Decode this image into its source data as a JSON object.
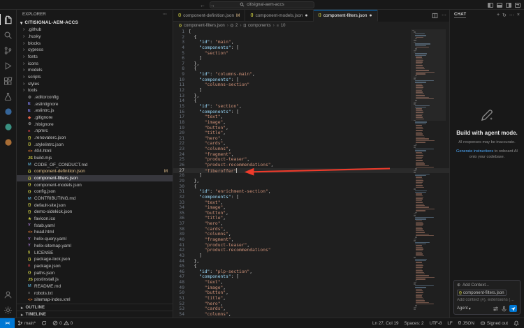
{
  "window": {
    "search_value": "citisignal-aem-accs"
  },
  "activity_bar": {
    "top": [
      {
        "name": "explorer",
        "active": true
      },
      {
        "name": "search",
        "active": false
      },
      {
        "name": "source-control",
        "active": false
      },
      {
        "name": "run-and-debug",
        "active": false
      },
      {
        "name": "extensions",
        "active": false
      },
      {
        "name": "testing",
        "active": false
      },
      {
        "name": "extension-blue",
        "active": false,
        "color": "#3f7fc4"
      },
      {
        "name": "extension-teal",
        "active": false,
        "color": "#45b8a5"
      },
      {
        "name": "extension-orange",
        "active": false,
        "color": "#d88a3f"
      }
    ],
    "bottom": [
      {
        "name": "accounts"
      },
      {
        "name": "settings"
      }
    ]
  },
  "sidebar": {
    "title": "EXPLORER",
    "more_label": "⋯",
    "root": "CITISIGNAL-AEM-ACCS",
    "items": [
      {
        "label": ".github",
        "icon": "folder"
      },
      {
        "label": ".husky",
        "icon": "folder"
      },
      {
        "label": "blocks",
        "icon": "folder"
      },
      {
        "label": "cypress",
        "icon": "folder"
      },
      {
        "label": "fonts",
        "icon": "folder"
      },
      {
        "label": "icons",
        "icon": "folder"
      },
      {
        "label": "models",
        "icon": "folder"
      },
      {
        "label": "scripts",
        "icon": "folder"
      },
      {
        "label": "styles",
        "icon": "folder"
      },
      {
        "label": "tools",
        "icon": "folder"
      },
      {
        "label": ".editorconfig",
        "icon": "gear"
      },
      {
        "label": ".eslintignore",
        "icon": "eslint"
      },
      {
        "label": ".eslintrc.js",
        "icon": "eslint"
      },
      {
        "label": ".gitignore",
        "icon": "git"
      },
      {
        "label": ".hlxignore",
        "icon": "gear"
      },
      {
        "label": ".npmrc",
        "icon": "npm"
      },
      {
        "label": ".renovaterc.json",
        "icon": "json"
      },
      {
        "label": ".stylelintrc.json",
        "icon": "json"
      },
      {
        "label": "404.html",
        "icon": "html"
      },
      {
        "label": "build.mjs",
        "icon": "js"
      },
      {
        "label": "CODE_OF_CONDUCT.md",
        "icon": "md"
      },
      {
        "label": "component-definition.json",
        "icon": "json",
        "git": "M"
      },
      {
        "label": "component-filters.json",
        "icon": "json",
        "selected": true
      },
      {
        "label": "component-models.json",
        "icon": "json"
      },
      {
        "label": "config.json",
        "icon": "json"
      },
      {
        "label": "CONTRIBUTING.md",
        "icon": "md"
      },
      {
        "label": "default-site.json",
        "icon": "json"
      },
      {
        "label": "demo-sidekick.json",
        "icon": "json"
      },
      {
        "label": "favicon.ico",
        "icon": "star"
      },
      {
        "label": "fstab.yaml",
        "icon": "yaml"
      },
      {
        "label": "head.html",
        "icon": "html"
      },
      {
        "label": "helix-query.yaml",
        "icon": "yaml"
      },
      {
        "label": "helix-sitemap.yaml",
        "icon": "yaml"
      },
      {
        "label": "LICENSE",
        "icon": "license"
      },
      {
        "label": "package-lock.json",
        "icon": "json"
      },
      {
        "label": "package.json",
        "icon": "npm"
      },
      {
        "label": "paths.json",
        "icon": "json"
      },
      {
        "label": "postinstall.js",
        "icon": "js"
      },
      {
        "label": "README.md",
        "icon": "md"
      },
      {
        "label": "robots.txt",
        "icon": "txt"
      },
      {
        "label": "sitemap-index.xml",
        "icon": "xml"
      }
    ],
    "bottom_sections": [
      "OUTLINE",
      "TIMELINE"
    ]
  },
  "tabs": [
    {
      "label": "component-definition.json",
      "icon": "json",
      "marker": "M",
      "active": false
    },
    {
      "label": "component-models.json",
      "icon": "json",
      "marker": "dot",
      "active": false
    },
    {
      "label": "component-filters.json",
      "icon": "json",
      "marker": "dot",
      "active": true
    }
  ],
  "breadcrumb": [
    {
      "label": "component-filters.json",
      "icon": "json"
    },
    {
      "label": "2",
      "icon": "object"
    },
    {
      "label": "components",
      "icon": "array"
    },
    {
      "label": "10",
      "icon": "string"
    }
  ],
  "editor": {
    "active_line": 27,
    "lines": [
      "[",
      "  {",
      "    \"id\": \"main\",",
      "    \"components\": [",
      "      \"section\"",
      "    ]",
      "  },",
      "  {",
      "    \"id\": \"columns-main\",",
      "    \"components\": [",
      "      \"columns-section\"",
      "    ]",
      "  },",
      "  {",
      "    \"id\": \"section\",",
      "    \"components\": [",
      "      \"text\",",
      "      \"image\",",
      "      \"button\",",
      "      \"title\",",
      "      \"hero\",",
      "      \"cards\",",
      "      \"columns\",",
      "      \"fragment\",",
      "      \"product-teaser\",",
      "      \"product-recommendations\",",
      "      \"fiberoffer\"",
      "    ]",
      "  },",
      "  {",
      "    \"id\": \"enrichment-section\",",
      "    \"components\": [",
      "      \"text\",",
      "      \"image\",",
      "      \"button\",",
      "      \"title\",",
      "      \"hero\",",
      "      \"cards\",",
      "      \"columns\",",
      "      \"fragment\",",
      "      \"product-teaser\",",
      "      \"product-recommendations\"",
      "    ]",
      "  },",
      "  {",
      "    \"id\": \"plp-section\",",
      "    \"components\": [",
      "      \"text\",",
      "      \"image\",",
      "      \"button\",",
      "      \"title\",",
      "      \"hero\",",
      "      \"cards\",",
      "      \"columns\","
    ]
  },
  "chat": {
    "title": "CHAT",
    "empty_title": "Build with agent mode.",
    "empty_note": "AI responses may be inaccurate.",
    "empty_link": "Generate instructions",
    "empty_link_rest": " to onboard AI onto your codebase.",
    "add_context_label": "Add Context...",
    "context_chip": "component-filters.json",
    "input_placeholder": "Add context (#), extensions (@), commands (/)",
    "mode_label": "Agent"
  },
  "status_bar": {
    "remote_label": "><",
    "branch_label": "main*",
    "errors": "0",
    "warnings": "0",
    "right": [
      {
        "name": "cursor-position",
        "label": "Ln 27, Col 19"
      },
      {
        "name": "indentation",
        "label": "Spaces: 2"
      },
      {
        "name": "encoding",
        "label": "UTF-8"
      },
      {
        "name": "eol",
        "label": "LF"
      },
      {
        "name": "language-mode",
        "label": "JSON",
        "icon": "braces"
      },
      {
        "name": "copilot-status",
        "label": "Signed out",
        "icon": "copilot"
      },
      {
        "name": "notifications",
        "label": "",
        "icon": "bell"
      }
    ]
  },
  "annotation": {
    "arrow_color": "#ee3b2b"
  }
}
